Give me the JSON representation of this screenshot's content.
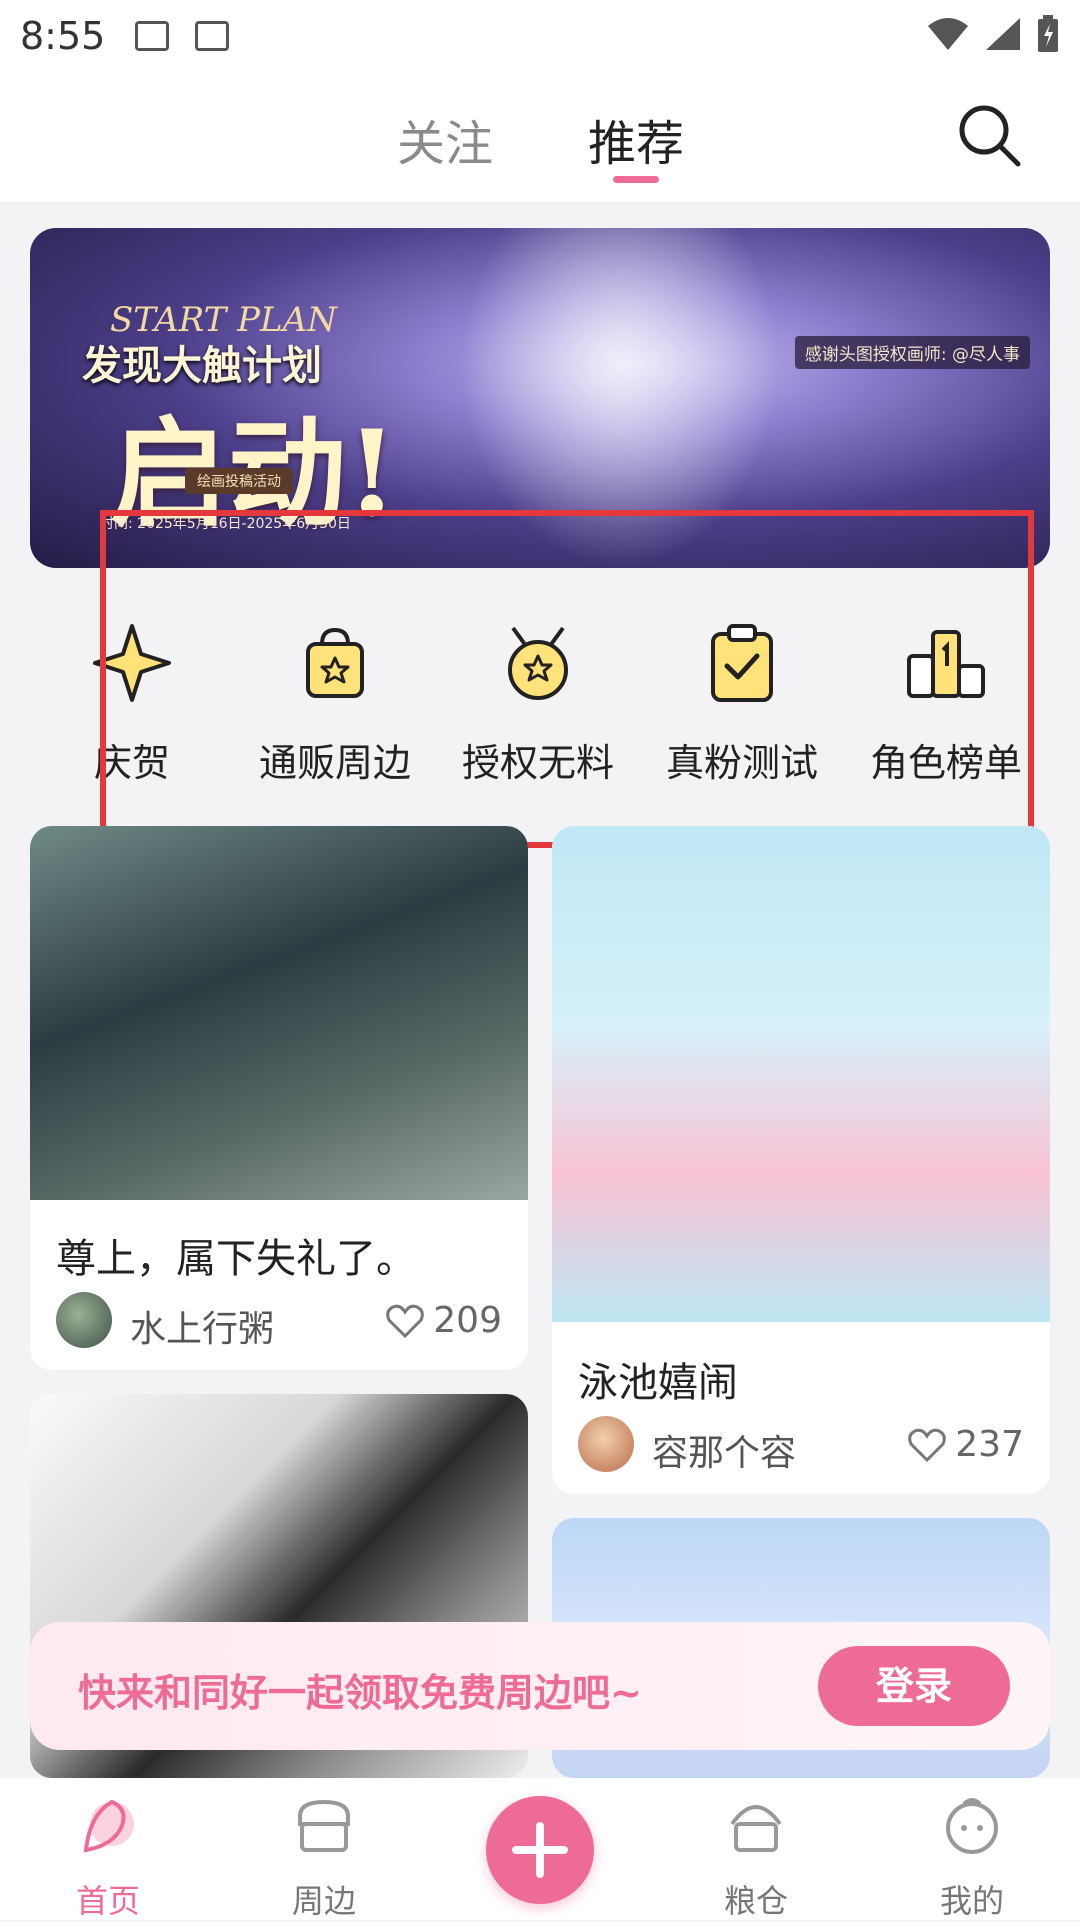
{
  "status": {
    "time": "8:55",
    "icons": [
      "image-icon",
      "keyboard-a-icon"
    ],
    "right_icons": [
      "wifi-icon",
      "signal-icon",
      "battery-icon"
    ]
  },
  "header": {
    "tabs": [
      {
        "label": "关注",
        "active": false
      },
      {
        "label": "推荐",
        "active": true
      }
    ],
    "search_icon": "search-icon"
  },
  "banner": {
    "eng": "START PLAN",
    "subtitle": "发现大触计划",
    "headline": "启动!",
    "pill": "绘画投稿活动",
    "dates": "时间: 2025年5月16日-2025年6月30日",
    "credit": "感谢头图授权画师: @尽人事"
  },
  "quick_links": [
    {
      "label": "庆贺",
      "icon": "sparkle-icon"
    },
    {
      "label": "通贩周边",
      "icon": "shopping-bag-icon"
    },
    {
      "label": "授权无料",
      "icon": "medal-icon"
    },
    {
      "label": "真粉测试",
      "icon": "clipboard-check-icon"
    },
    {
      "label": "角色榜单",
      "icon": "ranking-podium-icon"
    }
  ],
  "feed": [
    {
      "title": "尊上，属下失礼了。",
      "author": "水上行粥",
      "likes": "209"
    },
    {
      "title": "泳池嬉闹",
      "author": "容那个容",
      "likes": "237"
    }
  ],
  "toast": {
    "message": "快来和同好一起领取免费周边吧~",
    "button": "登录"
  },
  "nav": [
    {
      "label": "首页",
      "icon": "home-icon",
      "active": true
    },
    {
      "label": "周边",
      "icon": "shop-icon",
      "active": false
    },
    {
      "label": "粮仓",
      "icon": "granary-icon",
      "active": false
    },
    {
      "label": "我的",
      "icon": "profile-icon",
      "active": false
    }
  ],
  "colors": {
    "accent": "#ee6b95",
    "highlight_box": "#e4383c"
  }
}
